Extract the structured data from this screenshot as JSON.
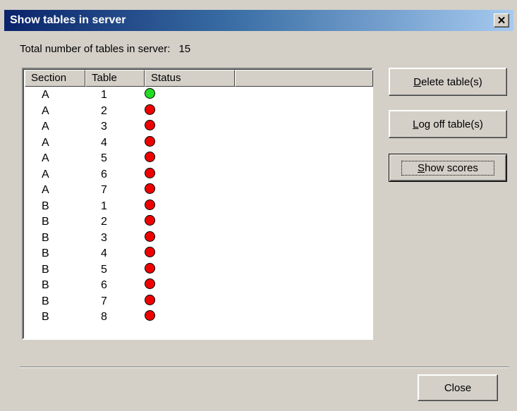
{
  "window": {
    "title": "Show tables in server",
    "close_glyph": "✕"
  },
  "summary": {
    "label": "Total number of tables in server:",
    "count": "15"
  },
  "list": {
    "columns": [
      "Section",
      "Table",
      "Status",
      ""
    ],
    "rows": [
      {
        "section": "A",
        "table": "1",
        "status": "green"
      },
      {
        "section": "A",
        "table": "2",
        "status": "red"
      },
      {
        "section": "A",
        "table": "3",
        "status": "red"
      },
      {
        "section": "A",
        "table": "4",
        "status": "red"
      },
      {
        "section": "A",
        "table": "5",
        "status": "red"
      },
      {
        "section": "A",
        "table": "6",
        "status": "red"
      },
      {
        "section": "A",
        "table": "7",
        "status": "red"
      },
      {
        "section": "B",
        "table": "1",
        "status": "red"
      },
      {
        "section": "B",
        "table": "2",
        "status": "red"
      },
      {
        "section": "B",
        "table": "3",
        "status": "red"
      },
      {
        "section": "B",
        "table": "4",
        "status": "red"
      },
      {
        "section": "B",
        "table": "5",
        "status": "red"
      },
      {
        "section": "B",
        "table": "6",
        "status": "red"
      },
      {
        "section": "B",
        "table": "7",
        "status": "red"
      },
      {
        "section": "B",
        "table": "8",
        "status": "red"
      }
    ],
    "status_colors": {
      "green": "#22dd22",
      "red": "#ee0000"
    }
  },
  "buttons": {
    "delete": {
      "accel": "D",
      "rest": "elete table(s)"
    },
    "logoff": {
      "accel": "L",
      "rest": "og off table(s)"
    },
    "scores": {
      "accel": "S",
      "rest": "how scores"
    },
    "close": "Close"
  }
}
